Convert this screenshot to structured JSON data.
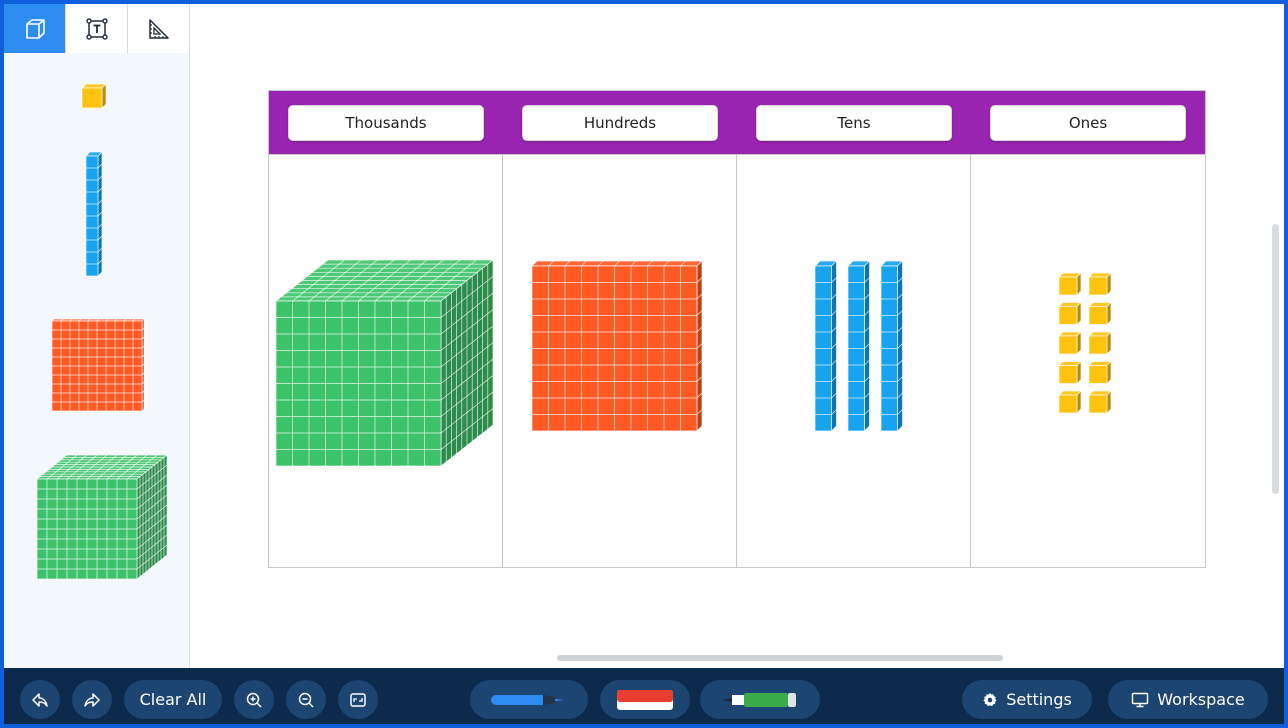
{
  "sidebar": {
    "tabs": [
      {
        "name": "blocks-tab",
        "icon": "cube-icon",
        "active": true
      },
      {
        "name": "text-tab",
        "icon": "text-box-icon",
        "active": false
      },
      {
        "name": "measure-tab",
        "icon": "set-square-icon",
        "active": false
      }
    ],
    "pieces": [
      "unit-cube",
      "ten-rod",
      "hundred-flat",
      "thousand-cube"
    ]
  },
  "chart": {
    "columns": [
      {
        "label": "Thousands",
        "count": 1
      },
      {
        "label": "Hundreds",
        "count": 1
      },
      {
        "label": "Tens",
        "count": 3
      },
      {
        "label": "Ones",
        "count": 10
      }
    ],
    "header_color": "#9b25b3"
  },
  "toolbar": {
    "clear_all_label": "Clear All",
    "settings_label": "Settings",
    "workspace_label": "Workspace"
  },
  "colors": {
    "cube_green": "#3cc36a",
    "flat_orange": "#ff5a24",
    "rod_blue": "#16a3ef",
    "unit_yellow": "#ffc20e",
    "active_tab": "#2c8cf0"
  }
}
